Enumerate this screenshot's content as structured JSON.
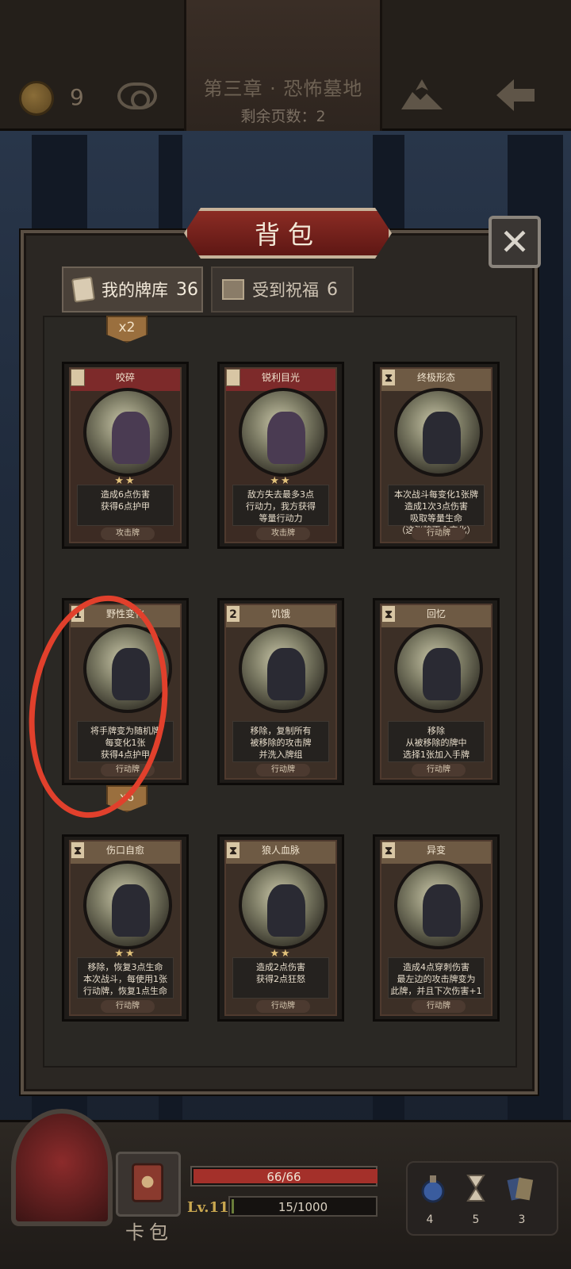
{
  "header": {
    "chapter_title": "第三章 · 恐怖墓地",
    "pages_left": "剩余页数：2",
    "coins": "9"
  },
  "panel": {
    "title": "背包",
    "close_label": "✕",
    "tabs": [
      {
        "label": "我的牌库",
        "count": "36",
        "active": true
      },
      {
        "label": "受到祝福",
        "count": "6",
        "active": false
      }
    ],
    "stack_badges": [
      "x2",
      "x6"
    ]
  },
  "cards": [
    {
      "cost": "",
      "name": "咬碎",
      "stars": "★★",
      "desc_line1": "造成6点伤害",
      "desc_line2": "获得6点护甲",
      "desc_line3": "",
      "desc_line4": "",
      "type": "攻击牌",
      "kind": "attack"
    },
    {
      "cost": "",
      "name": "锐利目光",
      "stars": "★★",
      "desc_line1": "敌方失去最多3点",
      "desc_line2": "行动力，我方获得",
      "desc_line3": "等量行动力",
      "desc_line4": "",
      "type": "攻击牌",
      "kind": "attack"
    },
    {
      "cost": "⧗",
      "name": "终极形态",
      "stars": "",
      "desc_line1": "本次战斗每变化1张牌",
      "desc_line2": "造成1次3点伤害",
      "desc_line3": "吸取等量生命",
      "desc_line4": "（这张牌不会变化）",
      "type": "行动牌",
      "kind": "action"
    },
    {
      "cost": "1",
      "name": "野性变化",
      "stars": "",
      "desc_line1": "将手牌变为随机牌",
      "desc_line2": "每变化1张",
      "desc_line3": "获得4点护甲",
      "desc_line4": "",
      "type": "行动牌",
      "kind": "action"
    },
    {
      "cost": "2",
      "name": "饥饿",
      "stars": "",
      "desc_line1": "移除，复制所有",
      "desc_line2": "被移除的攻击牌",
      "desc_line3": "并洗入牌组",
      "desc_line4": "",
      "type": "行动牌",
      "kind": "action"
    },
    {
      "cost": "⧗",
      "name": "回忆",
      "stars": "",
      "desc_line1": "移除",
      "desc_line2": "从被移除的牌中",
      "desc_line3": "选择1张加入手牌",
      "desc_line4": "",
      "type": "行动牌",
      "kind": "action"
    },
    {
      "cost": "⧗",
      "name": "伤口自愈",
      "stars": "★★",
      "desc_line1": "移除，恢复3点生命",
      "desc_line2": "本次战斗，每使用1张",
      "desc_line3": "行动牌，恢复1点生命",
      "desc_line4": "",
      "type": "行动牌",
      "kind": "action"
    },
    {
      "cost": "⧗",
      "name": "狼人血脉",
      "stars": "★★",
      "desc_line1": "造成2点伤害",
      "desc_line2": "获得2点狂怒",
      "desc_line3": "",
      "desc_line4": "",
      "type": "行动牌",
      "kind": "action"
    },
    {
      "cost": "⧗",
      "name": "异变",
      "stars": "",
      "desc_line1": "造成4点穿刺伤害",
      "desc_line2": "最左边的攻击牌变为",
      "desc_line3": "此牌，并且下次伤害+1",
      "desc_line4": "",
      "type": "行动牌",
      "kind": "action"
    }
  ],
  "hud": {
    "deck_label": "卡包",
    "hp_text": "66/66",
    "hp_fraction": 1.0,
    "level": "Lv.11",
    "xp_text": "15/1000",
    "xp_fraction": 0.015,
    "items": [
      {
        "icon": "potion-icon",
        "count": "4"
      },
      {
        "icon": "hourglass-icon",
        "count": "5"
      },
      {
        "icon": "cards-icon",
        "count": "3"
      }
    ]
  }
}
